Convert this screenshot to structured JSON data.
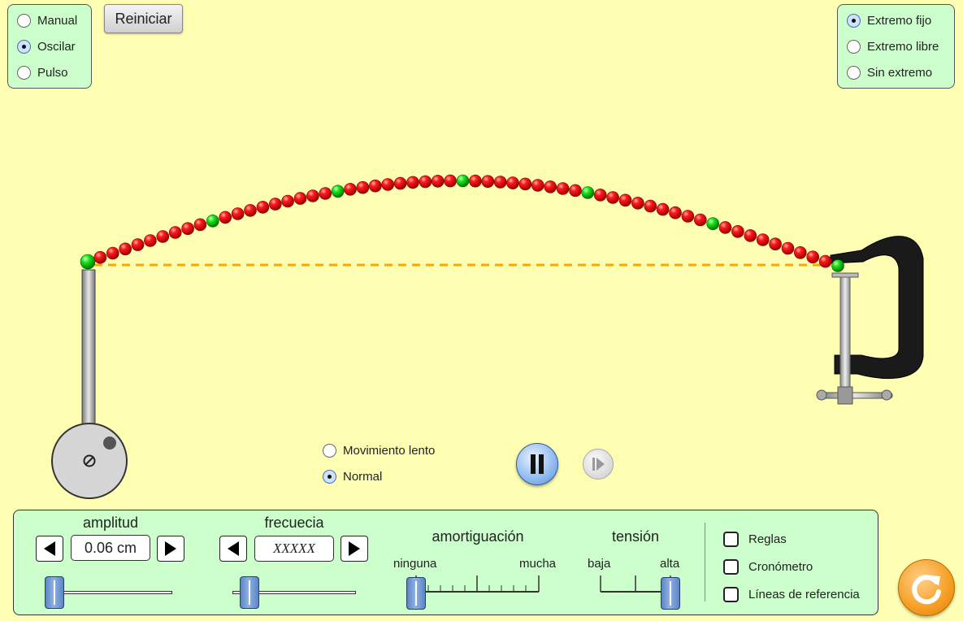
{
  "mode_options": [
    {
      "label": "Manual",
      "selected": false
    },
    {
      "label": "Oscilar",
      "selected": true
    },
    {
      "label": "Pulso",
      "selected": false
    }
  ],
  "reset_label": "Reiniciar",
  "end_options": [
    {
      "label": "Extremo fijo",
      "selected": true
    },
    {
      "label": "Extremo libre",
      "selected": false
    },
    {
      "label": "Sin extremo",
      "selected": false
    }
  ],
  "speed_options": [
    {
      "label": "Movimiento lento",
      "selected": false
    },
    {
      "label": "Normal",
      "selected": true
    }
  ],
  "controls": {
    "amplitude": {
      "title": "amplitud",
      "value": "0.06 cm",
      "level": 0.05
    },
    "frequency": {
      "title": "frecuecia",
      "value": "XXXXX",
      "level": 0.1
    },
    "damping": {
      "title": "amortiguación",
      "min_label": "ninguna",
      "max_label": "mucha",
      "level": 0.0
    },
    "tension": {
      "title": "tensión",
      "min_label": "baja",
      "max_label": "alta",
      "level": 1.0
    }
  },
  "checkboxes": [
    {
      "label": "Reglas",
      "checked": false
    },
    {
      "label": "Cronómetro",
      "checked": false
    },
    {
      "label": "Líneas de referencia",
      "checked": false
    }
  ],
  "colors": {
    "background": "#ffffb3",
    "panel": "#ccffcc",
    "bead": "#e60000",
    "bead_marker": "#00cc00",
    "reference_line": "#ffa500",
    "reset_all": "#f59a1d"
  },
  "icons": {
    "pause": "pause-icon",
    "step": "step-icon",
    "reset_all": "refresh-icon",
    "left": "triangle-left-icon",
    "right": "triangle-right-icon"
  }
}
